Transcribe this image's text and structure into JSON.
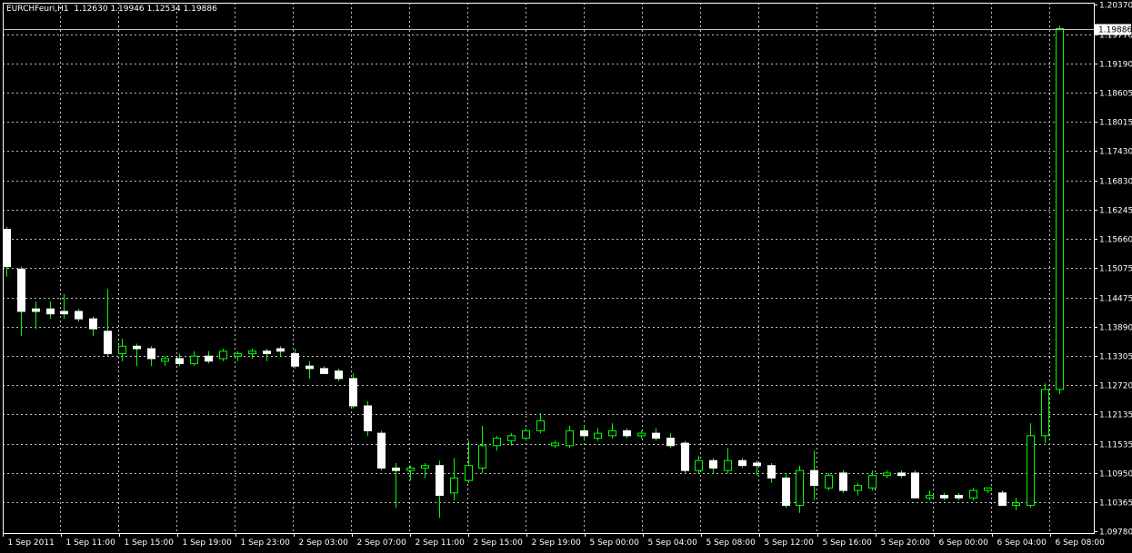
{
  "window": {
    "symbol": "EURCHFeuri,H1",
    "ohlc": "1.12630 1.19946 1.12534 1.19886"
  },
  "current_price_label": "1.19886",
  "colors": {
    "background": "#000000",
    "grid": "#c0c0c0",
    "axis": "#ffffff",
    "up_body": "#000000",
    "down_body": "#ffffff",
    "wick": "#00ff00",
    "text": "#ffffff"
  },
  "chart_data": {
    "type": "candlestick",
    "title": "EURCHFeuri,H1  1.12630 1.19946 1.12534 1.19886",
    "grid": true,
    "ylim": [
      1.0978,
      1.2037
    ],
    "y_ticks": [
      "1.20370",
      "1.19770",
      "1.19190",
      "1.18605",
      "1.18015",
      "1.17430",
      "1.16830",
      "1.16245",
      "1.15660",
      "1.15075",
      "1.14475",
      "1.13890",
      "1.13305",
      "1.12720",
      "1.12135",
      "1.11535",
      "1.10950",
      "1.10365",
      "1.09780"
    ],
    "x_ticks": [
      "1 Sep 2011",
      "1 Sep 11:00",
      "1 Sep 15:00",
      "1 Sep 19:00",
      "1 Sep 23:00",
      "2 Sep 03:00",
      "2 Sep 07:00",
      "2 Sep 11:00",
      "2 Sep 15:00",
      "2 Sep 19:00",
      "5 Sep 00:00",
      "5 Sep 04:00",
      "5 Sep 08:00",
      "5 Sep 12:00",
      "5 Sep 16:00",
      "5 Sep 20:00",
      "6 Sep 00:00",
      "6 Sep 04:00",
      "6 Sep 08:00"
    ],
    "candles": [
      {
        "o": 1.1585,
        "h": 1.159,
        "l": 1.149,
        "c": 1.151
      },
      {
        "o": 1.1505,
        "h": 1.151,
        "l": 1.137,
        "c": 1.142
      },
      {
        "o": 1.1425,
        "h": 1.144,
        "l": 1.1385,
        "c": 1.142
      },
      {
        "o": 1.1425,
        "h": 1.144,
        "l": 1.1405,
        "c": 1.1415
      },
      {
        "o": 1.142,
        "h": 1.1455,
        "l": 1.1405,
        "c": 1.1415
      },
      {
        "o": 1.142,
        "h": 1.1425,
        "l": 1.14,
        "c": 1.1405
      },
      {
        "o": 1.1405,
        "h": 1.141,
        "l": 1.137,
        "c": 1.1385
      },
      {
        "o": 1.138,
        "h": 1.1465,
        "l": 1.133,
        "c": 1.1335
      },
      {
        "o": 1.1335,
        "h": 1.1365,
        "l": 1.132,
        "c": 1.135
      },
      {
        "o": 1.135,
        "h": 1.1355,
        "l": 1.131,
        "c": 1.1345
      },
      {
        "o": 1.1345,
        "h": 1.135,
        "l": 1.131,
        "c": 1.1325
      },
      {
        "o": 1.132,
        "h": 1.133,
        "l": 1.131,
        "c": 1.1325
      },
      {
        "o": 1.1325,
        "h": 1.1335,
        "l": 1.131,
        "c": 1.1315
      },
      {
        "o": 1.1315,
        "h": 1.134,
        "l": 1.131,
        "c": 1.133
      },
      {
        "o": 1.133,
        "h": 1.134,
        "l": 1.1315,
        "c": 1.132
      },
      {
        "o": 1.1325,
        "h": 1.1345,
        "l": 1.132,
        "c": 1.134
      },
      {
        "o": 1.133,
        "h": 1.134,
        "l": 1.132,
        "c": 1.1335
      },
      {
        "o": 1.1335,
        "h": 1.1345,
        "l": 1.1325,
        "c": 1.134
      },
      {
        "o": 1.134,
        "h": 1.1345,
        "l": 1.132,
        "c": 1.1335
      },
      {
        "o": 1.1345,
        "h": 1.135,
        "l": 1.133,
        "c": 1.134
      },
      {
        "o": 1.1335,
        "h": 1.1345,
        "l": 1.1305,
        "c": 1.131
      },
      {
        "o": 1.131,
        "h": 1.132,
        "l": 1.1285,
        "c": 1.1305
      },
      {
        "o": 1.1305,
        "h": 1.131,
        "l": 1.1295,
        "c": 1.1295
      },
      {
        "o": 1.13,
        "h": 1.1305,
        "l": 1.128,
        "c": 1.1285
      },
      {
        "o": 1.1285,
        "h": 1.1295,
        "l": 1.1225,
        "c": 1.123
      },
      {
        "o": 1.123,
        "h": 1.124,
        "l": 1.117,
        "c": 1.118
      },
      {
        "o": 1.1175,
        "h": 1.118,
        "l": 1.11,
        "c": 1.1105
      },
      {
        "o": 1.1105,
        "h": 1.1115,
        "l": 1.1025,
        "c": 1.11
      },
      {
        "o": 1.11,
        "h": 1.111,
        "l": 1.108,
        "c": 1.1105
      },
      {
        "o": 1.1105,
        "h": 1.1115,
        "l": 1.1085,
        "c": 1.111
      },
      {
        "o": 1.111,
        "h": 1.112,
        "l": 1.1005,
        "c": 1.105
      },
      {
        "o": 1.1055,
        "h": 1.1125,
        "l": 1.104,
        "c": 1.1085
      },
      {
        "o": 1.108,
        "h": 1.116,
        "l": 1.1075,
        "c": 1.111
      },
      {
        "o": 1.1105,
        "h": 1.119,
        "l": 1.1095,
        "c": 1.115
      },
      {
        "o": 1.115,
        "h": 1.117,
        "l": 1.114,
        "c": 1.1165
      },
      {
        "o": 1.116,
        "h": 1.1175,
        "l": 1.115,
        "c": 1.117
      },
      {
        "o": 1.1165,
        "h": 1.1185,
        "l": 1.116,
        "c": 1.118
      },
      {
        "o": 1.118,
        "h": 1.1215,
        "l": 1.1175,
        "c": 1.12
      },
      {
        "o": 1.115,
        "h": 1.116,
        "l": 1.1145,
        "c": 1.1155
      },
      {
        "o": 1.115,
        "h": 1.119,
        "l": 1.1145,
        "c": 1.118
      },
      {
        "o": 1.118,
        "h": 1.119,
        "l": 1.116,
        "c": 1.117
      },
      {
        "o": 1.1165,
        "h": 1.1185,
        "l": 1.116,
        "c": 1.1175
      },
      {
        "o": 1.117,
        "h": 1.1195,
        "l": 1.1165,
        "c": 1.118
      },
      {
        "o": 1.118,
        "h": 1.1185,
        "l": 1.1165,
        "c": 1.117
      },
      {
        "o": 1.117,
        "h": 1.118,
        "l": 1.1165,
        "c": 1.1175
      },
      {
        "o": 1.1175,
        "h": 1.1185,
        "l": 1.116,
        "c": 1.1165
      },
      {
        "o": 1.1165,
        "h": 1.1175,
        "l": 1.1145,
        "c": 1.115
      },
      {
        "o": 1.1155,
        "h": 1.116,
        "l": 1.1095,
        "c": 1.11
      },
      {
        "o": 1.11,
        "h": 1.113,
        "l": 1.1095,
        "c": 1.112
      },
      {
        "o": 1.112,
        "h": 1.1125,
        "l": 1.1095,
        "c": 1.1105
      },
      {
        "o": 1.11,
        "h": 1.1145,
        "l": 1.1095,
        "c": 1.112
      },
      {
        "o": 1.112,
        "h": 1.1125,
        "l": 1.1105,
        "c": 1.111
      },
      {
        "o": 1.1115,
        "h": 1.112,
        "l": 1.109,
        "c": 1.111
      },
      {
        "o": 1.111,
        "h": 1.1115,
        "l": 1.1075,
        "c": 1.1085
      },
      {
        "o": 1.1085,
        "h": 1.1095,
        "l": 1.1025,
        "c": 1.103
      },
      {
        "o": 1.103,
        "h": 1.111,
        "l": 1.1015,
        "c": 1.11
      },
      {
        "o": 1.11,
        "h": 1.114,
        "l": 1.104,
        "c": 1.107
      },
      {
        "o": 1.1065,
        "h": 1.1095,
        "l": 1.106,
        "c": 1.109
      },
      {
        "o": 1.1095,
        "h": 1.11,
        "l": 1.1055,
        "c": 1.106
      },
      {
        "o": 1.106,
        "h": 1.1075,
        "l": 1.105,
        "c": 1.107
      },
      {
        "o": 1.1065,
        "h": 1.11,
        "l": 1.106,
        "c": 1.109
      },
      {
        "o": 1.109,
        "h": 1.11,
        "l": 1.1085,
        "c": 1.1095
      },
      {
        "o": 1.1095,
        "h": 1.11,
        "l": 1.1085,
        "c": 1.109
      },
      {
        "o": 1.1095,
        "h": 1.11,
        "l": 1.1045,
        "c": 1.1045
      },
      {
        "o": 1.1045,
        "h": 1.106,
        "l": 1.104,
        "c": 1.105
      },
      {
        "o": 1.105,
        "h": 1.1055,
        "l": 1.104,
        "c": 1.1045
      },
      {
        "o": 1.105,
        "h": 1.1055,
        "l": 1.104,
        "c": 1.1045
      },
      {
        "o": 1.1045,
        "h": 1.1065,
        "l": 1.104,
        "c": 1.106
      },
      {
        "o": 1.106,
        "h": 1.1065,
        "l": 1.1055,
        "c": 1.1065
      },
      {
        "o": 1.1055,
        "h": 1.106,
        "l": 1.103,
        "c": 1.103
      },
      {
        "o": 1.103,
        "h": 1.1045,
        "l": 1.102,
        "c": 1.1035
      },
      {
        "o": 1.103,
        "h": 1.1195,
        "l": 1.1025,
        "c": 1.117
      },
      {
        "o": 1.117,
        "h": 1.1275,
        "l": 1.1155,
        "c": 1.1263
      },
      {
        "o": 1.1263,
        "h": 1.19946,
        "l": 1.12534,
        "c": 1.19886
      }
    ]
  }
}
